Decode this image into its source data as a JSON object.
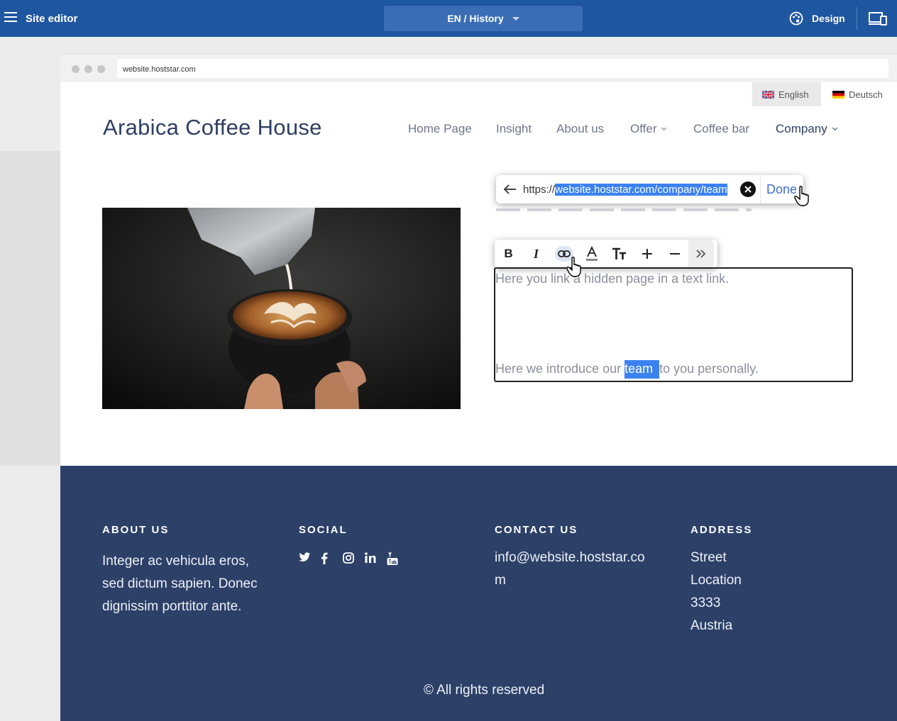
{
  "editor": {
    "title": "Site editor",
    "center_label": "EN / History",
    "design_label": "Design"
  },
  "browser": {
    "url": "website.hoststar.com"
  },
  "site": {
    "languages": [
      {
        "label": "English"
      },
      {
        "label": "Deutsch"
      }
    ],
    "logo": "Arabica Coffee House",
    "nav": [
      {
        "label": "Home Page"
      },
      {
        "label": "Insight"
      },
      {
        "label": "About us"
      },
      {
        "label": "Offer"
      },
      {
        "label": "Coffee bar"
      },
      {
        "label": "Company"
      }
    ]
  },
  "link_popup": {
    "url_prefix": "https://",
    "url_selected": "website.hoststar.com/company/team",
    "done_label": "Done"
  },
  "toolbar_icons": [
    "bold",
    "italic",
    "link",
    "text-color",
    "text-size",
    "increase",
    "decrease",
    "more"
  ],
  "editor_text": {
    "line1": "Here you link a hidden page in a text link.",
    "line2_before": "Here we introduce our ",
    "line2_selected": "team ",
    "line2_after": "to you personally."
  },
  "footer": {
    "about_heading": "ABOUT US",
    "about_text_1": "Integer ac vehicula eros,",
    "about_text_2": "sed dictum sapien. Donec",
    "about_text_3": "dignissim porttitor ante.",
    "social_heading": "SOCIAL",
    "social_icons": [
      "twitter-icon",
      "facebook-icon",
      "instagram-icon",
      "linkedin-icon",
      "youtube-icon"
    ],
    "contact_heading": "CONTACT US",
    "contact_email_1": "info@website.hoststar.co",
    "contact_email_2": "m",
    "address_heading": "ADDRESS",
    "address_lines": [
      "Street",
      "Location",
      "3333",
      "Austria"
    ],
    "copyright": "© All rights reserved"
  },
  "colors": {
    "editor_bar": "#1f56a0",
    "footer_bg": "#2c4068",
    "selection": "#3b82f0",
    "brand_text": "#2e3f63"
  }
}
